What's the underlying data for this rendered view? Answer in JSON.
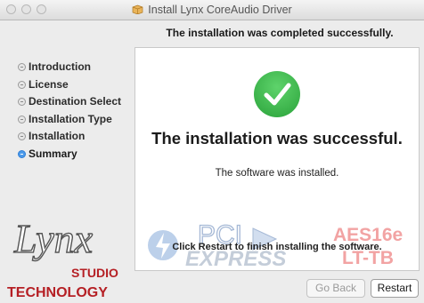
{
  "window": {
    "title": "Install Lynx CoreAudio Driver"
  },
  "header": {
    "subtitle": "The installation was completed successfully."
  },
  "sidebar": {
    "steps": [
      {
        "label": "Introduction",
        "active": false
      },
      {
        "label": "License",
        "active": false
      },
      {
        "label": "Destination Select",
        "active": false
      },
      {
        "label": "Installation Type",
        "active": false
      },
      {
        "label": "Installation",
        "active": false
      },
      {
        "label": "Summary",
        "active": true
      }
    ]
  },
  "main": {
    "headline": "The installation was successful.",
    "message": "The software was installed.",
    "restart_note": "Click Restart to finish installing the software."
  },
  "logos": {
    "pci_top": "PCI",
    "pci_bottom": "EXPRESS",
    "aes_top": "AES16e",
    "aes_bottom": "LT-TB",
    "lynx_script": "Lynx",
    "lynx_studio": "STUDIO",
    "lynx_technology": "TECHNOLOGY"
  },
  "buttons": {
    "go_back": "Go Back",
    "restart": "Restart"
  },
  "colors": {
    "accent_blue": "#2f7fd6",
    "check_green": "#2aa23a",
    "lynx_red": "#b51f24",
    "watermark_red": "#f07a7a",
    "watermark_blue": "#7fa7d6"
  },
  "icons": {
    "window_controls": [
      "close-icon",
      "minimize-icon",
      "zoom-icon"
    ],
    "title": "package-icon",
    "status": "checkmark-icon"
  }
}
